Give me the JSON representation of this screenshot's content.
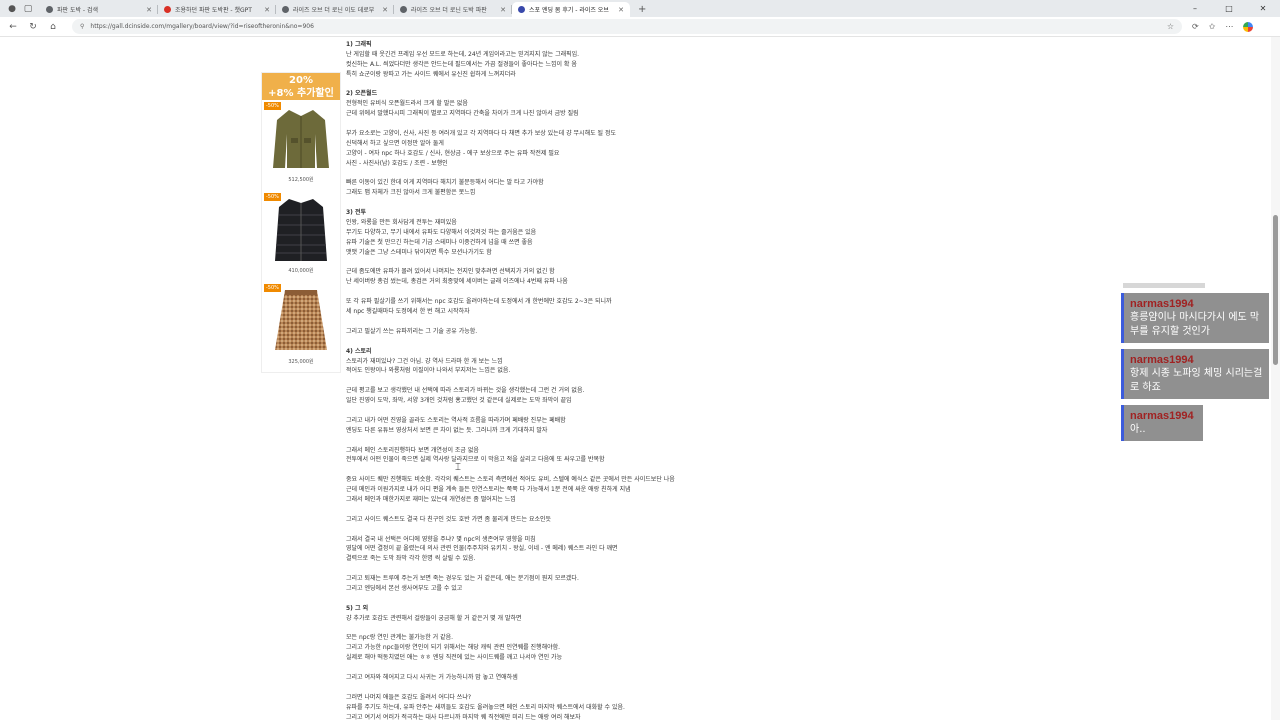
{
  "browser": {
    "tabs": [
      {
        "title": "파판 도박 - 검색",
        "favicon_color": "#5f6368",
        "favicon_glyph": "search-icon"
      },
      {
        "title": "조용하던 파판 도박판 - 챗GPT",
        "favicon_color": "#d93025",
        "favicon_glyph": "red-round-icon"
      },
      {
        "title": "라이즈 오브 더 로닌 이도 데로부",
        "favicon_color": "#5f6368",
        "favicon_glyph": "search-icon"
      },
      {
        "title": "라이즈 오브 더 로닌 도박 파판",
        "favicon_color": "#5f6368",
        "favicon_glyph": "search-icon"
      },
      {
        "title": "스포 엔딩 봄 후기 - 라이즈 오브",
        "favicon_color": "#3949ab",
        "favicon_glyph": "dc-icon",
        "active": true
      }
    ],
    "new_tab_label": "+",
    "url": "https://gall.dcinside.com/mgallery/board/view/?id=riseoftheronin&no=906",
    "window_controls": {
      "minimize": "–",
      "maximize": "□",
      "close": "✕"
    }
  },
  "ad": {
    "banner_line1": "20%",
    "banner_line2": "+8% 추가할인",
    "items": [
      {
        "badge": "-50%",
        "price": "512,500원",
        "product_icon": "jacket-icon"
      },
      {
        "badge": "-50%",
        "price": "410,000원",
        "product_icon": "puffer-icon"
      },
      {
        "badge": "-50%",
        "price": "325,000원",
        "product_icon": "skirt-icon"
      }
    ]
  },
  "article": {
    "lines": [
      {
        "t": "1) 그래픽",
        "head": true
      },
      {
        "t": "난 게임할 때 웃긴건 프레임 우선 모드로 하는데, 24년 게임이라고는 믿겨지지 않는 그래픽임."
      },
      {
        "t": "컷신하는 A.L. 씌었다더만 생각은 안드는데 필드에서는 가끔 절경들이 좋아다는 느낌이 확 옴"
      },
      {
        "t": "특히 쇼군이랑 왕따고 가는 사이드 퀘에서 유신진 쉽하게 느껴지더라"
      },
      {
        "t": ""
      },
      {
        "t": "2) 오픈월드",
        "head": true
      },
      {
        "t": "전형적인 유비식 오픈월드라서 크게 할 말은 없음"
      },
      {
        "t": "근데 위에서 말했다시피 그래픽이 별로고 지역마다 간축을 차이가 크게 나진 않아서 금방 질림"
      },
      {
        "t": ""
      },
      {
        "t": "부가 요소로는 고양이, 신사, 사진 등 여러개 있고 각 지역마다 다 채면 추가 보상 있는데 걍 무시해도 될 정도"
      },
      {
        "t": "신덕해서 하고 싶으면 이정만 알아 둘게"
      },
      {
        "t": "고양이 - 여자 npc 하나 호감도 / 신사, 현상금 - 에구 보상으로 주는 유파 작전제 필요"
      },
      {
        "t": "사진 - 사진사(남) 호감도          / 조련 - 보행인"
      },
      {
        "t": ""
      },
      {
        "t": "빠른 이동이 있긴 한데 이게 지역마다 해치기 불문등해서 어디는 말 타고 가야함"
      },
      {
        "t": "그래도 맵 자체가 크진 않아서 크게 불편함은 못느낌"
      },
      {
        "t": ""
      },
      {
        "t": "3) 전투",
        "head": true
      },
      {
        "t": "인왕, 와룡을 만든 회사답게 전투는 재미있음"
      },
      {
        "t": "무기도 다양하고, 무기 내에서 유파도 다양해서 이것저것 하는 즐거움은 있음"
      },
      {
        "t": "유파 기술은 첫 만으긴 하는데 기금 스테미나 이중건하게 넘을 때 쓰면 좋음"
      },
      {
        "t": "맷맷 기술은 그냥 스테미나 닦이지면 특수 모션나가기도 함"
      },
      {
        "t": ""
      },
      {
        "t": "근데 좀도에만 유파가 몰려 있어서 나머지는 전지인 맞추려면 선택지가 거의 없긴 함"
      },
      {
        "t": "난 세이버랑 총검 썼는데, 총검은 거의 최종맞에 세이버는 글래 이즈에나 4번째 유파 나옴"
      },
      {
        "t": ""
      },
      {
        "t": "또 각 유파 필살기를 쓰기 위해서는 npc 호감도 올려야하는데 도정에서 개 한번에만 호감도 2~3은 되니까"
      },
      {
        "t": "세 npc 챙길때마다 도정에서 한 번 해고 시작하자"
      },
      {
        "t": ""
      },
      {
        "t": "그리고 필살기 쓰는 유파끼리는 그 기술 공유 가능함."
      },
      {
        "t": ""
      },
      {
        "t": "4) 스토리",
        "head": true
      },
      {
        "t": "스토리가 재미있냐? 그건 아님. 걍 역사 드라마 한 개 보는 느낌"
      },
      {
        "t": "적어도 인왕이나 와룡처럼 이질이야 나와서 부지저는 느낌은 없음."
      },
      {
        "t": ""
      },
      {
        "t": "근데 평고를 보고 생각했던 내 선택에 따라 스토리가 바뀌는 것을 생각했는데 그런 건 거의 없음."
      },
      {
        "t": "일단 진영이 도막, 좌막, 서양 3개인 것처럼 홍고했던 것 같은데 실제로는 도막 좌막이 끝임"
      },
      {
        "t": ""
      },
      {
        "t": "그리고 내가 어떤 진영을 골라도 스토리는 역사적 흐름을 따라가며 페배랑 진부는 페배함"
      },
      {
        "t": "엔딩도 다른 유튜브 영상처서 보면 큰 차이 없는 듯. 그러니까 크게 기대하지 말자"
      },
      {
        "t": ""
      },
      {
        "t": "그래서 메인 스토리진행하다 보면 개연성이 조금 없음"
      },
      {
        "t": "전투에서 어떤 인물이 죽으면 실제 역사랑 달라지므로 이 막음고 적을 살리고 다음에 또 싸우고를 반복함"
      },
      {
        "t": ""
      },
      {
        "t": "중요 사이드 퀘만 진행해도 비슷함. 각각의 퀘스트는 스토리 측면에선 적어도 유비, 스텔에 예식스 같은 곳에서 만든 사이드보단 나음"
      },
      {
        "t": "근데 메인과 이원가지로 내가 어디 편을 계속 들든 인연스토리는 쭉쭉 다 가능해서 1분 전에 싸운 애랑 친하게 지냄"
      },
      {
        "t": "그래서 메인과 매한가지로 재미는 있는데 개연성은 좀 떨어지는 느낌"
      },
      {
        "t": ""
      },
      {
        "t": "그리고 사이드 퀘스트도 결국 다 친구인 것도 호반 가면 좀 물리게 만드는 요소인듯"
      },
      {
        "t": ""
      },
      {
        "t": "그래서 결국 내 선택은 어디에 영향을 주냐? 몇 npc의 생존여부 영향을 미침"
      },
      {
        "t": "영달에 어떤 결정이 끝 올렸는데 의사 관련 인물(주주치와 유키치 - 왕실, 이네 - 엔 메레) 퀘스트 라인 다 깨면"
      },
      {
        "t": "결력으로 죽는 도막 좌막 각각 한명 씩 살릴 수 있음."
      },
      {
        "t": ""
      },
      {
        "t": "그리고 퇴재는 트루에 주는거 보면 죽는 경우도 있는 거 같은데, 애는 분기점이 뭔지 모르겠다."
      },
      {
        "t": "그리고 엔딩에서 본선 생사여부도 고를 수 있고"
      },
      {
        "t": ""
      },
      {
        "t": "5) 그 외",
        "head": true
      },
      {
        "t": "걍 추가로 호감도 관련해서 걸랑들이 궁금해 할 거 같은거 몇 개 말하면"
      },
      {
        "t": ""
      },
      {
        "t": "모든 npc랑 연인 관계는 불가능한 거 같음."
      },
      {
        "t": "그리고 가능한 npc들이랑 연인이 되기 위해서는 해당 캐릭 관련 인연퀘를 진행해야함."
      },
      {
        "t": "실제로 해야 떡동치였던 애는 ㅎㅎ 엔딩 직전에 있는 사이드퀘를 깨고 나서야 연인 가능"
      },
      {
        "t": ""
      },
      {
        "t": "그리고 여자와 헤어지고 다시 사귀는 거 가능하니까 맘 놓고 연애하셈"
      },
      {
        "t": ""
      },
      {
        "t": "그러면 나머지 애들은 호감도 올려서 어디다 쓰냐?"
      },
      {
        "t": "유파를 주기도 하는데, 유파 안주는 새끼들도 호감도 올려놓으면 메인 스토리 마지막 퀘스트에서 대화할 수 있음."
      },
      {
        "t": "그리고 여기서 여러가 적극하는 대사 다르니까 마지막 퀘 직전에만 미리 드는 애랑 여러 해보자"
      }
    ]
  },
  "chat": {
    "accent_color": "#3b5bdb",
    "username_color": "#a02222",
    "messages": [
      {
        "user": "narmas1994",
        "text": "흥릉얌이나 마시다가시 에도 막부를 유지할 것인가"
      },
      {
        "user": "narmas1994",
        "text": "항제 시종 노파잉 체밍 시리는걸로 하죠"
      },
      {
        "user": "narmas1994",
        "text": "아.."
      }
    ]
  }
}
